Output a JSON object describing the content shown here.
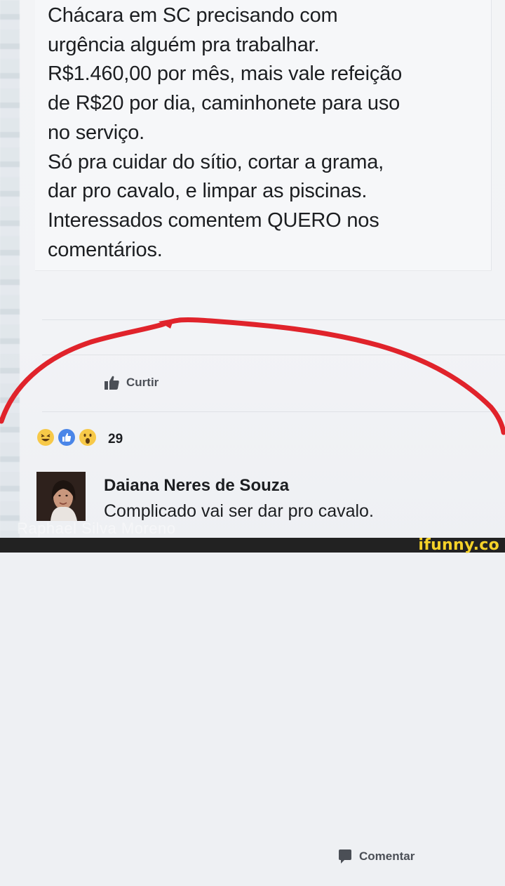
{
  "post": {
    "lines": [
      "Chácara em SC precisando com",
      "urgência alguém pra trabalhar.",
      "R$1.460,00 por mês, mais vale refeição",
      "de R$20 por dia, caminhonete para uso",
      "no serviço.",
      "Só pra cuidar do sítio, cortar a grama,",
      "dar pro cavalo, e limpar as piscinas.",
      "Interessados comentem QUERO nos",
      "comentários."
    ]
  },
  "actions": {
    "like_label": "Curtir",
    "comment_label": "Comentar"
  },
  "reactions": {
    "count": "29",
    "icons": [
      "haha-icon",
      "like-icon",
      "wow-icon"
    ]
  },
  "comment": {
    "author": "Daiana Neres de Souza",
    "text": "Complicado vai ser dar pro cavalo."
  },
  "watermark": "Raphael Silva Moreno",
  "brand": "ifunny.co",
  "colors": {
    "text": "#1c1e21",
    "action_text": "#4b4f56",
    "like_blue": "#4267b2",
    "annotation_red": "#e0232b",
    "ifunny_yellow": "#f5d229"
  }
}
